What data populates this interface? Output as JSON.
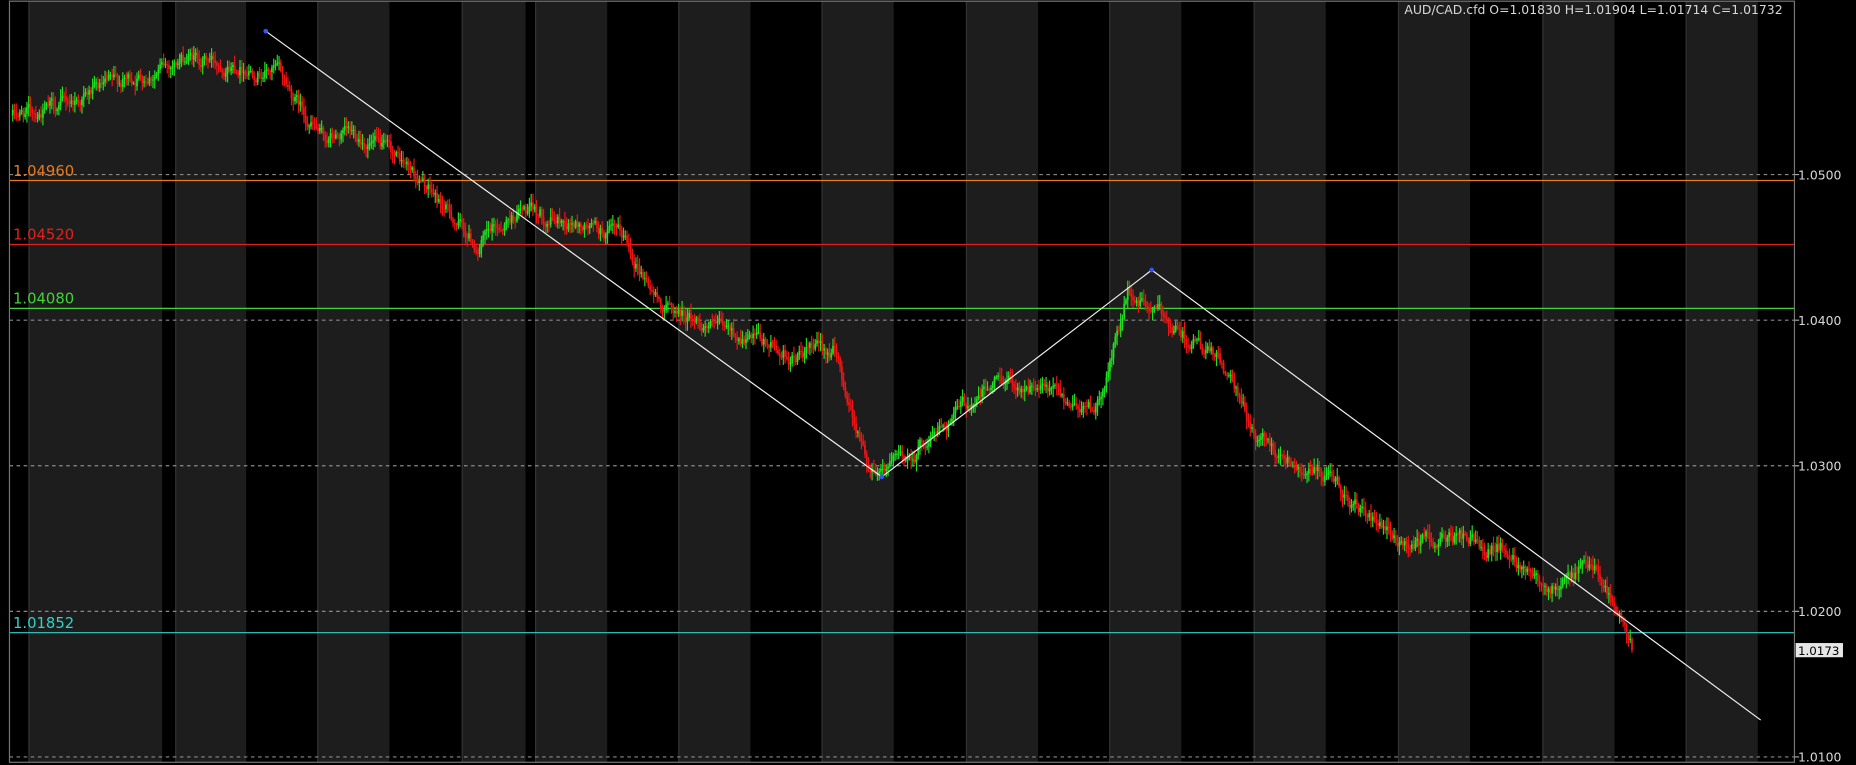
{
  "chart_data": {
    "type": "candlestick",
    "symbol_info": "AUD/CAD.cfd O=1.01830 H=1.01904 L=1.01714 C=1.01732",
    "ylim": [
      1.0096,
      1.06186
    ],
    "y_ticks": [
      "1.0500",
      "1.0400",
      "1.0300",
      "1.0200",
      "1.0100"
    ],
    "grid": "dotted horizontal",
    "current_price": "1.0173",
    "levels": [
      {
        "value": 1.0496,
        "label": "1.04960",
        "color": "#e87a1d"
      },
      {
        "value": 1.0452,
        "label": "1.04520",
        "color": "#e3201c"
      },
      {
        "value": 1.0408,
        "label": "1.04080",
        "color": "#3fd336"
      },
      {
        "value": 1.01852,
        "label": "1.01852",
        "color": "#33d1c8"
      }
    ],
    "price_path": [
      {
        "bar": 0,
        "price": 1.054
      },
      {
        "bar": 22,
        "price": 1.0545
      },
      {
        "bar": 55,
        "price": 1.056
      },
      {
        "bar": 78,
        "price": 1.057
      },
      {
        "bar": 100,
        "price": 1.058
      },
      {
        "bar": 128,
        "price": 1.0575
      },
      {
        "bar": 150,
        "price": 1.057
      },
      {
        "bar": 160,
        "price": 1.055
      },
      {
        "bar": 175,
        "price": 1.0523
      },
      {
        "bar": 195,
        "price": 1.0527
      },
      {
        "bar": 222,
        "price": 1.0505
      },
      {
        "bar": 242,
        "price": 1.0478
      },
      {
        "bar": 262,
        "price": 1.045
      },
      {
        "bar": 285,
        "price": 1.0475
      },
      {
        "bar": 318,
        "price": 1.0465
      },
      {
        "bar": 345,
        "price": 1.0455
      },
      {
        "bar": 365,
        "price": 1.041
      },
      {
        "bar": 400,
        "price": 1.0392
      },
      {
        "bar": 440,
        "price": 1.0375
      },
      {
        "bar": 462,
        "price": 1.038
      },
      {
        "bar": 482,
        "price": 1.03
      },
      {
        "bar": 502,
        "price": 1.0303
      },
      {
        "bar": 530,
        "price": 1.0335
      },
      {
        "bar": 558,
        "price": 1.036
      },
      {
        "bar": 592,
        "price": 1.0345
      },
      {
        "bar": 612,
        "price": 1.034
      },
      {
        "bar": 628,
        "price": 1.0418
      },
      {
        "bar": 650,
        "price": 1.04
      },
      {
        "bar": 680,
        "price": 1.037
      },
      {
        "bar": 700,
        "price": 1.032
      },
      {
        "bar": 740,
        "price": 1.029
      },
      {
        "bar": 780,
        "price": 1.0245
      },
      {
        "bar": 810,
        "price": 1.025
      },
      {
        "bar": 838,
        "price": 1.0245
      },
      {
        "bar": 870,
        "price": 1.0215
      },
      {
        "bar": 892,
        "price": 1.0233
      },
      {
        "bar": 912,
        "price": 1.0173
      }
    ],
    "trendlines": [
      {
        "from": {
          "bar": 143,
          "price": 1.0598
        },
        "to": {
          "bar": 490,
          "price": 1.0292
        }
      },
      {
        "from": {
          "bar": 490,
          "price": 1.0292
        },
        "to": {
          "bar": 642,
          "price": 1.0434
        }
      },
      {
        "from": {
          "bar": 642,
          "price": 1.0434
        },
        "to": {
          "bar": 985,
          "price": 1.0125
        }
      }
    ],
    "session_bands": [
      {
        "from": 24,
        "to": 137
      },
      {
        "from": 148,
        "to": 208
      },
      {
        "from": 268,
        "to": 329
      },
      {
        "from": 390,
        "to": 444
      },
      {
        "from": 452,
        "to": 513
      },
      {
        "from": 573,
        "to": 634
      },
      {
        "from": 694,
        "to": 755
      },
      {
        "from": 816,
        "to": 877
      },
      {
        "from": 937,
        "to": 998
      },
      {
        "from": 1059,
        "to": 1120
      },
      {
        "from": 1181,
        "to": 1242
      },
      {
        "from": 1303,
        "to": 1364
      },
      {
        "from": 1424,
        "to": 1485
      }
    ]
  }
}
